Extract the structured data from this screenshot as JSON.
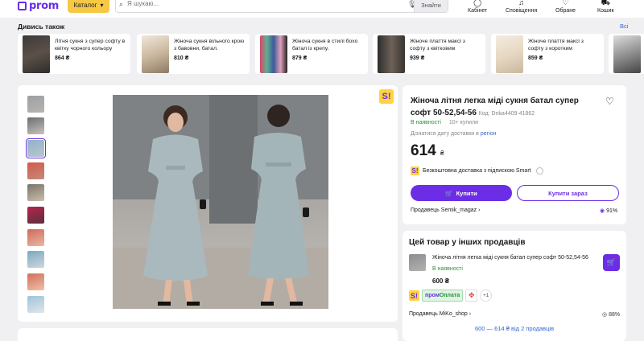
{
  "header": {
    "logo_text": "prom",
    "catalog_label": "Каталог",
    "search_placeholder": "Я шукаю...",
    "search_button": "Знайти",
    "nav": [
      {
        "label": "Кабінет",
        "icon": "user-icon"
      },
      {
        "label": "Сповіщення",
        "icon": "bell-icon"
      },
      {
        "label": "Обране",
        "icon": "heart-icon"
      },
      {
        "label": "Кошик",
        "icon": "cart-icon"
      }
    ]
  },
  "recommendations": {
    "title": "Дивись також",
    "all_link": "Всі",
    "items": [
      {
        "title": "Літня сукня з супер софту в квітку чорного кольору",
        "price": "864 ₴"
      },
      {
        "title": "Жіноча сукня вільного крою з бавовни, батал.",
        "price": "810 ₴"
      },
      {
        "title": "Жіноча сукня в стилі бохо батал із крепу.",
        "price": "879 ₴"
      },
      {
        "title": "Жіноче плаття максі з софту з квітковим",
        "price": "939 ₴"
      },
      {
        "title": "Жіноче плаття максі з софту з коротким",
        "price": "859 ₴"
      }
    ]
  },
  "gallery": {
    "thumb_count": 10,
    "active_index": 2
  },
  "product": {
    "title": "Жіноча літня легка міді сукня батал супер софт 50-52,54-56",
    "code": "Код: Dnka4409-41862",
    "stock": "В наявності",
    "bought": "10+ купили",
    "delivery_prefix": "Дізнатися дату доставки в",
    "delivery_link": "регіон",
    "price": "614",
    "currency": "₴",
    "smart_text": "Безкоштовна доставка з підпискою Smart",
    "buy_label": "Купити",
    "buy_now_label": "Купити зараз",
    "seller": "Продавець Semik_magaz",
    "rating": "91%"
  },
  "other_sellers": {
    "title": "Цей товар у інших продавців",
    "item_name": "Жіноча літня легка міді сукня батал супер софт 50-52,54-56",
    "item_stock": "В наявності",
    "item_price": "600 ₴",
    "pay_label_a": "пром",
    "pay_label_b": "Оплата",
    "pay_more": "+1",
    "seller": "Продавець MiKo_shop",
    "rating": "88%",
    "range_link": "600 — 614 ₴ від 2 продавців"
  },
  "colors": {
    "brand": "#6b2ee6",
    "catalog": "#f7c843",
    "in_stock": "#2f8f3a",
    "link": "#3366cc"
  }
}
